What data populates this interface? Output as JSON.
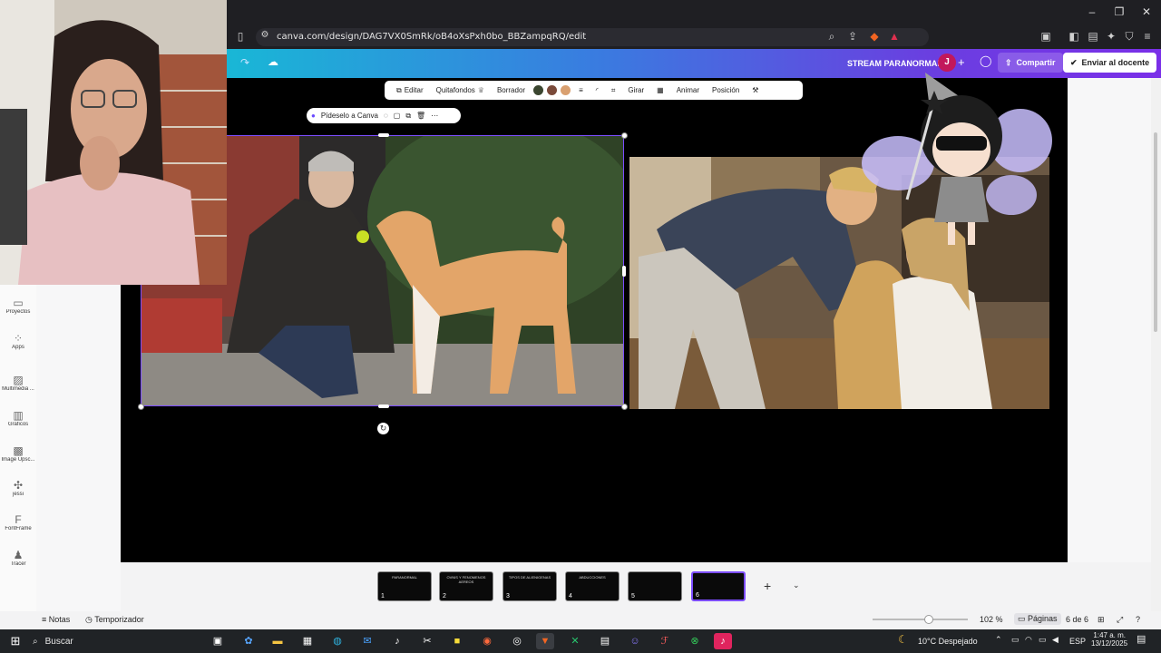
{
  "browser": {
    "url": "canva.com/design/DAG7VX0SmRk/oB4oXsPxh0bo_BBZampqRQ/edit"
  },
  "canva_header": {
    "title": "STREAM PARANORMAL",
    "avatar_initial": "J",
    "share_label": "Compartir",
    "send_label": "Enviar al docente"
  },
  "toolbar": {
    "edit": "Editar",
    "remove_bg": "Quitafondos",
    "eraser": "Borrador",
    "swatches": [
      "#3b4630",
      "#7a4a3a",
      "#d9a070"
    ],
    "rotate": "Girar",
    "animate": "Animar",
    "position": "Posición"
  },
  "ask_canva": "Pídeselo a Canva",
  "sidebar": {
    "items": [
      {
        "label": "Proyectos",
        "icon": "folder-icon"
      },
      {
        "label": "Apps",
        "icon": "apps-icon"
      },
      {
        "label": "Multimedia ...",
        "icon": "media-icon"
      },
      {
        "label": "Gráficos",
        "icon": "chart-icon"
      },
      {
        "label": "Image Upsc...",
        "icon": "image-upscale-icon"
      },
      {
        "label": "jessi",
        "icon": "sparkle-icon"
      },
      {
        "label": "FontFrame",
        "icon": "fontframe-icon"
      },
      {
        "label": "Tracer",
        "icon": "tracer-icon"
      }
    ]
  },
  "pages": {
    "thumbnails": [
      {
        "number": "1",
        "caption": "PARANORMAL"
      },
      {
        "number": "2",
        "caption": "OVNIS Y FENOMENOS AEREOS"
      },
      {
        "number": "3",
        "caption": "TIPOS DE ALIENIGENAS"
      },
      {
        "number": "4",
        "caption": "ABDUCCIONES"
      },
      {
        "number": "5",
        "caption": ""
      },
      {
        "number": "6",
        "caption": ""
      }
    ],
    "active": 6
  },
  "status": {
    "notes": "Notas",
    "timer": "Temporizador",
    "zoom": "102 %",
    "pages_label": "Páginas",
    "page_count": "6 de 6"
  },
  "taskbar": {
    "search": "Buscar",
    "weather": "10°C  Despejado",
    "lang": "ESP",
    "time": "1:47 a. m.",
    "date": "13/12/2025"
  }
}
